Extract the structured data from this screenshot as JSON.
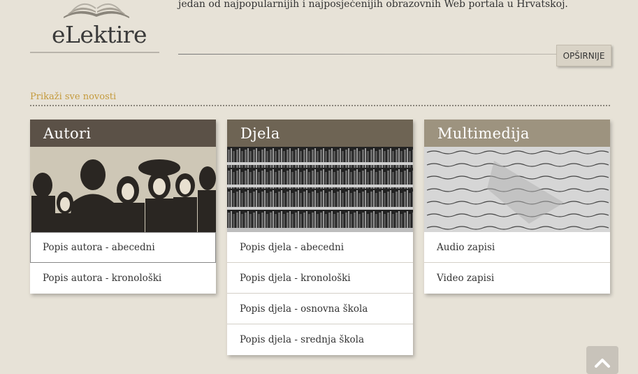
{
  "logo": {
    "text": "eLektire"
  },
  "intro": {
    "text": "jedan od najpopularnijih i najposjećenijih obrazovnih Web portala u Hrvatskoj."
  },
  "more_button": {
    "label": "OPŠIRNIJE"
  },
  "news_link": {
    "label": "Prikaži sve novosti"
  },
  "cards": [
    {
      "title": "Autori",
      "header_color": "#5b5147",
      "items": [
        "Popis autora - abecedni",
        "Popis autora - kronološki"
      ]
    },
    {
      "title": "Djela",
      "header_color": "#6e6454",
      "items": [
        "Popis djela - abecedni",
        "Popis djela - kronološki",
        "Popis djela - osnovna škola",
        "Popis djela - srednja škola"
      ]
    },
    {
      "title": "Multimedija",
      "header_color": "#9d937f",
      "items": [
        "Audio zapisi",
        "Video zapisi"
      ]
    }
  ],
  "scroll_top": {
    "icon": "chevron-up-icon"
  }
}
